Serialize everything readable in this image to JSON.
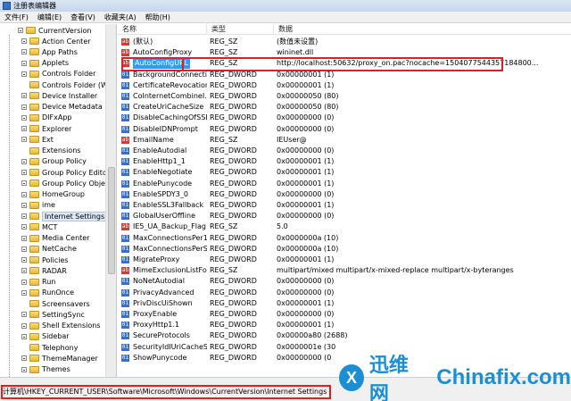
{
  "window": {
    "title": "注册表编辑器"
  },
  "menu": [
    "文件(F)",
    "编辑(E)",
    "查看(V)",
    "收藏夹(A)",
    "帮助(H)"
  ],
  "tree": {
    "root": "CurrentVersion",
    "items": [
      "Action Center",
      "App Paths",
      "Applets",
      "Controls Folder",
      "Controls Folder (Wc",
      "Device Installer",
      "Device Metadata",
      "DIFxApp",
      "Explorer",
      "Ext",
      "Extensions",
      "Group Policy",
      "Group Policy Editor",
      "Group Policy Object",
      "HomeGroup",
      "ime",
      "Internet Settings",
      "MCT",
      "Media Center",
      "NetCache",
      "Policies",
      "RADAR",
      "Run",
      "RunOnce",
      "Screensavers",
      "SettingSync",
      "Shell Extensions",
      "Sidebar",
      "Telephony",
      "ThemeManager",
      "Themes"
    ],
    "selected_index": 16
  },
  "list": {
    "columns": {
      "name": "名称",
      "type": "类型",
      "data": "数据"
    },
    "rows": [
      {
        "name": "(默认)",
        "type": "REG_SZ",
        "data": "(数值未设置)",
        "kind": "sz"
      },
      {
        "name": "AutoConfigProxy",
        "type": "REG_SZ",
        "data": "wininet.dll",
        "kind": "sz"
      },
      {
        "name": "AutoConfigURL",
        "type": "REG_SZ",
        "data": "http://localhost:50632/proxy_on.pac?nocache=1504077544357184800...",
        "kind": "sz"
      },
      {
        "name": "BackgroundConnecti...",
        "type": "REG_DWORD",
        "data": "0x00000001 (1)",
        "kind": "dword"
      },
      {
        "name": "CertificateRevocation",
        "type": "REG_DWORD",
        "data": "0x00000001 (1)",
        "kind": "dword"
      },
      {
        "name": "CoInternetCombineI...",
        "type": "REG_DWORD",
        "data": "0x00000050 (80)",
        "kind": "dword"
      },
      {
        "name": "CreateUriCacheSize",
        "type": "REG_DWORD",
        "data": "0x00000050 (80)",
        "kind": "dword"
      },
      {
        "name": "DisableCachingOfSSL...",
        "type": "REG_DWORD",
        "data": "0x00000000 (0)",
        "kind": "dword"
      },
      {
        "name": "DisableIDNPrompt",
        "type": "REG_DWORD",
        "data": "0x00000000 (0)",
        "kind": "dword"
      },
      {
        "name": "EmailName",
        "type": "REG_SZ",
        "data": "IEUser@",
        "kind": "sz"
      },
      {
        "name": "EnableAutodial",
        "type": "REG_DWORD",
        "data": "0x00000000 (0)",
        "kind": "dword"
      },
      {
        "name": "EnableHttp1_1",
        "type": "REG_DWORD",
        "data": "0x00000001 (1)",
        "kind": "dword"
      },
      {
        "name": "EnableNegotiate",
        "type": "REG_DWORD",
        "data": "0x00000001 (1)",
        "kind": "dword"
      },
      {
        "name": "EnablePunycode",
        "type": "REG_DWORD",
        "data": "0x00000001 (1)",
        "kind": "dword"
      },
      {
        "name": "EnableSPDY3_0",
        "type": "REG_DWORD",
        "data": "0x00000000 (0)",
        "kind": "dword"
      },
      {
        "name": "EnableSSL3Fallback",
        "type": "REG_DWORD",
        "data": "0x00000001 (1)",
        "kind": "dword"
      },
      {
        "name": "GlobalUserOffline",
        "type": "REG_DWORD",
        "data": "0x00000000 (0)",
        "kind": "dword"
      },
      {
        "name": "IE5_UA_Backup_Flag",
        "type": "REG_SZ",
        "data": "5.0",
        "kind": "sz"
      },
      {
        "name": "MaxConnectionsPer1...",
        "type": "REG_DWORD",
        "data": "0x0000000a (10)",
        "kind": "dword"
      },
      {
        "name": "MaxConnectionsPerS...",
        "type": "REG_DWORD",
        "data": "0x0000000a (10)",
        "kind": "dword"
      },
      {
        "name": "MigrateProxy",
        "type": "REG_DWORD",
        "data": "0x00000001 (1)",
        "kind": "dword"
      },
      {
        "name": "MimeExclusionListFo...",
        "type": "REG_SZ",
        "data": "multipart/mixed multipart/x-mixed-replace multipart/x-byteranges",
        "kind": "sz"
      },
      {
        "name": "NoNetAutodial",
        "type": "REG_DWORD",
        "data": "0x00000000 (0)",
        "kind": "dword"
      },
      {
        "name": "PrivacyAdvanced",
        "type": "REG_DWORD",
        "data": "0x00000000 (0)",
        "kind": "dword"
      },
      {
        "name": "PrivDiscUiShown",
        "type": "REG_DWORD",
        "data": "0x00000001 (1)",
        "kind": "dword"
      },
      {
        "name": "ProxyEnable",
        "type": "REG_DWORD",
        "data": "0x00000000 (0)",
        "kind": "dword"
      },
      {
        "name": "ProxyHttp1.1",
        "type": "REG_DWORD",
        "data": "0x00000001 (1)",
        "kind": "dword"
      },
      {
        "name": "SecureProtocols",
        "type": "REG_DWORD",
        "data": "0x00000a80 (2688)",
        "kind": "dword"
      },
      {
        "name": "SecurityIdIUriCacheSi...",
        "type": "REG_DWORD",
        "data": "0x0000001e (30",
        "kind": "dword"
      },
      {
        "name": "ShowPunycode",
        "type": "REG_DWORD",
        "data": "0x00000000 (0",
        "kind": "dword"
      }
    ],
    "selected_index": 2
  },
  "status": {
    "path": "计算机\\HKEY_CURRENT_USER\\Software\\Microsoft\\Windows\\CurrentVersion\\Internet Settings"
  },
  "watermark": {
    "logo": "X",
    "cn": "迅维网",
    "en": "Chinafix.com"
  },
  "colors": {
    "highlight": "#e02020",
    "selection": "#3399ff",
    "watermark": "#1a8fd6"
  }
}
